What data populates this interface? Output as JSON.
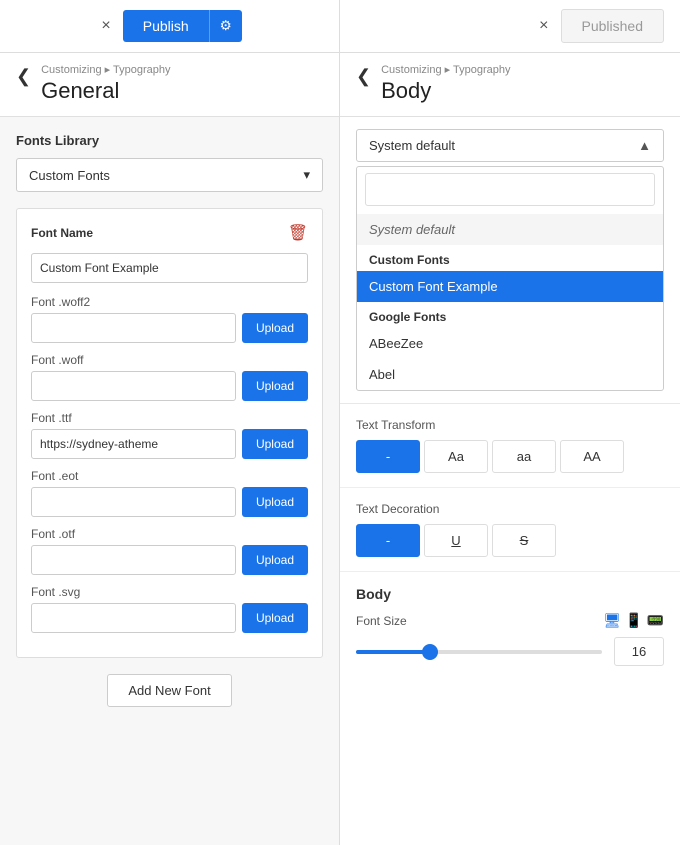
{
  "topbar": {
    "left_close_label": "×",
    "publish_label": "Publish",
    "gear_label": "⚙",
    "right_close_label": "×",
    "published_label": "Published"
  },
  "left_panel": {
    "breadcrumb": "Customizing ▸ Typography",
    "title": "General",
    "back_arrow": "❮",
    "fonts_library": {
      "section_title": "Fonts Library",
      "dropdown_value": "Custom Fonts",
      "dropdown_arrow": "▾"
    },
    "font_card": {
      "label": "Font Name",
      "delete_icon": "🗑",
      "font_name_value": "Custom Font Example",
      "fields": [
        {
          "label": "Font .woff2",
          "value": ""
        },
        {
          "label": "Font .woff",
          "value": ""
        },
        {
          "label": "Font .ttf",
          "value": "https://sydney-atheme"
        },
        {
          "label": "Font .eot",
          "value": ""
        },
        {
          "label": "Font .otf",
          "value": ""
        },
        {
          "label": "Font .svg",
          "value": ""
        }
      ],
      "upload_label": "Upload"
    },
    "add_new_font_label": "Add New Font"
  },
  "right_panel": {
    "breadcrumb": "Customizing ▸ Typography",
    "title": "Body",
    "back_arrow": "❮",
    "font_selector": {
      "selected_value": "System default",
      "arrow": "▲",
      "search_placeholder": "",
      "groups": [
        {
          "label": null,
          "options": [
            {
              "text": "System default",
              "type": "system-default",
              "selected": false
            }
          ]
        },
        {
          "label": "Custom Fonts",
          "options": [
            {
              "text": "Custom Font Example",
              "type": "normal",
              "selected": true
            }
          ]
        },
        {
          "label": "Google Fonts",
          "options": [
            {
              "text": "ABeeZee",
              "type": "normal",
              "selected": false
            },
            {
              "text": "Abel",
              "type": "normal",
              "selected": false
            }
          ]
        }
      ]
    },
    "text_transform": {
      "label": "Text Transform",
      "options": [
        {
          "value": "-",
          "active": true
        },
        {
          "value": "Aa",
          "active": false
        },
        {
          "value": "aa",
          "active": false
        },
        {
          "value": "AA",
          "active": false
        }
      ]
    },
    "text_decoration": {
      "label": "Text Decoration",
      "options": [
        {
          "value": "-",
          "active": true
        },
        {
          "value": "U̲",
          "active": false
        },
        {
          "value": "S̶",
          "active": false
        }
      ]
    },
    "body_section": {
      "title": "Body",
      "font_size_label": "Font Size",
      "font_size_value": "16",
      "slider_percent": 30
    }
  }
}
